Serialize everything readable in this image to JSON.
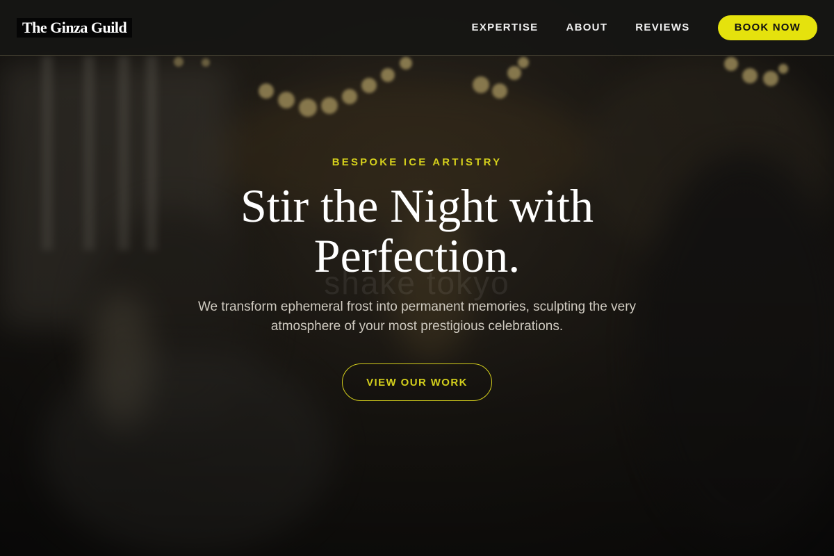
{
  "header": {
    "logo": "The Ginza Guild",
    "nav": [
      {
        "label": "EXPERTISE"
      },
      {
        "label": "ABOUT"
      },
      {
        "label": "REVIEWS"
      }
    ],
    "cta_label": "BOOK NOW"
  },
  "hero": {
    "eyebrow": "BESPOKE ICE ARTISTRY",
    "headline": "Stir the Night with Perfection.",
    "subtext": "We transform ephemeral frost into permanent memories, sculpting the very atmosphere of your most prestigious celebrations.",
    "watermark": "shake tokyo",
    "button_label": "VIEW OUR WORK"
  },
  "colors": {
    "accent": "#e5e20d",
    "accent_text": "#d4cf1c",
    "header_bg": "#161513"
  }
}
